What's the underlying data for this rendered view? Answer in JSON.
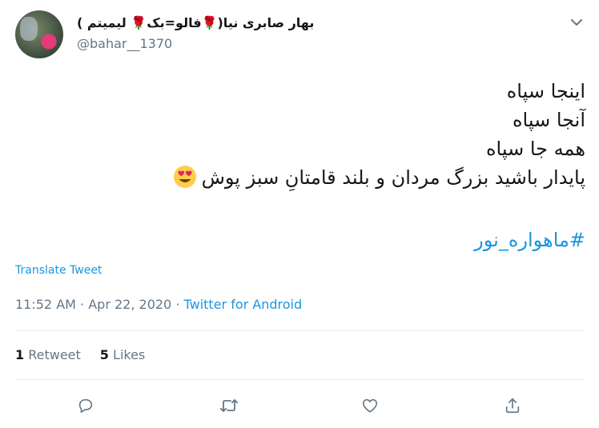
{
  "author": {
    "display_name": "بهار صابری نیا(🌹فالو=بک🌹 لیمیتم )",
    "handle": "@bahar__1370"
  },
  "tweet": {
    "lines": [
      "اینجا سپاه",
      "آنجا سپاه",
      "همه جا سپاه",
      "پایدار باشید بزرگ مردان و بلند قامتانِ سبز پوش"
    ],
    "hashtag": "#ماهواره_نور"
  },
  "translate_label": "Translate Tweet",
  "meta": {
    "time": "11:52 AM",
    "separator1": " · ",
    "date": "Apr 22, 2020",
    "separator2": " · ",
    "source": "Twitter for Android"
  },
  "stats": {
    "retweets_count": "1",
    "retweets_label": "Retweet",
    "likes_count": "5",
    "likes_label": "Likes"
  },
  "icons": {
    "more": "chevron-down-icon",
    "emoji": "heart-eyes-emoji-icon",
    "reply": "reply-icon",
    "retweet": "retweet-icon",
    "like": "like-icon",
    "share": "share-icon"
  },
  "colors": {
    "link": "#1b95e0",
    "secondary_text": "#657786",
    "icon": "#657786",
    "divider": "#e6ecf0"
  }
}
